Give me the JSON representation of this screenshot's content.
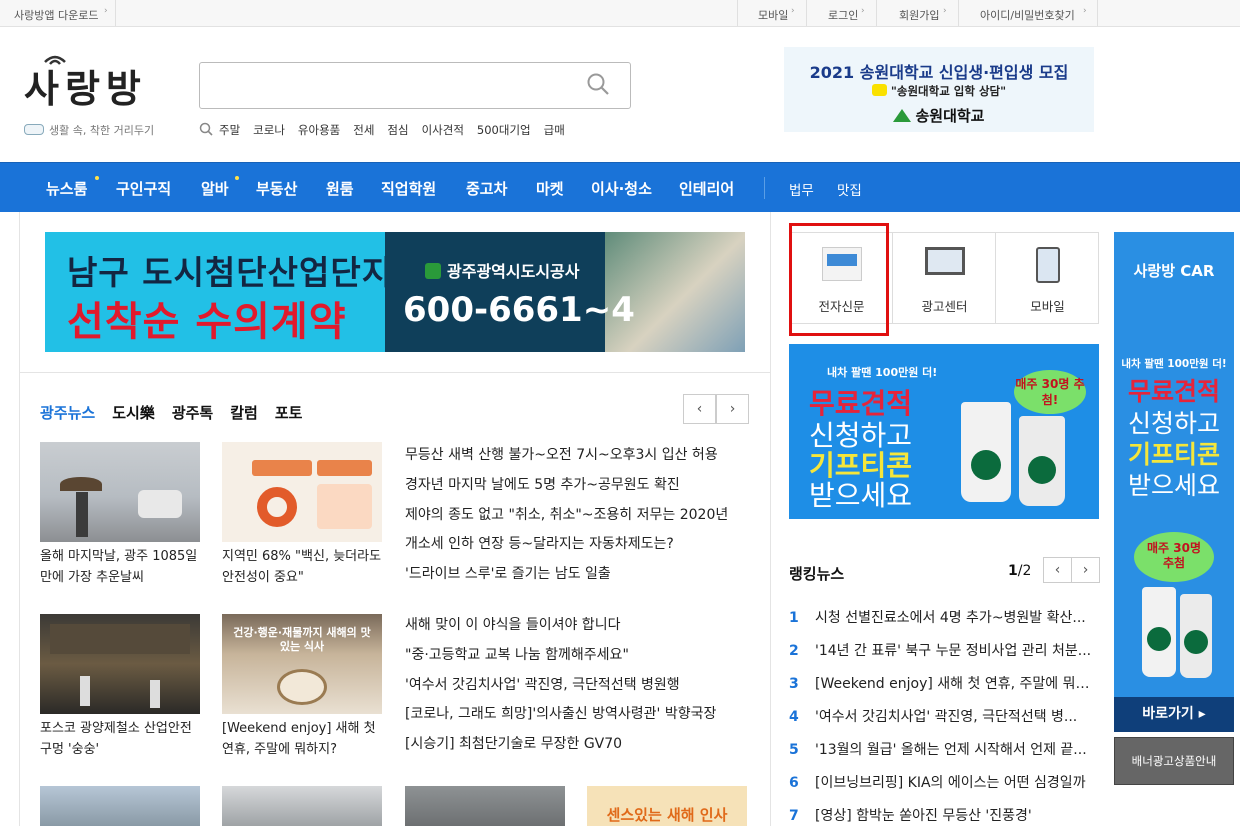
{
  "topbar": {
    "app_download": "사랑방앱 다운로드",
    "mobile": "모바일",
    "login": "로그인",
    "signup": "회원가입",
    "find_account": "아이디/비밀번호찾기"
  },
  "header": {
    "logo_text": "사랑방",
    "slogan": "생활 속, 착한 거리두기",
    "search_placeholder": "",
    "hot_keywords": [
      "주말",
      "코로나",
      "유아용품",
      "전세",
      "점심",
      "이사견적",
      "500대기업",
      "급매"
    ]
  },
  "top_ad": {
    "line1": "2021 송원대학교 신입생·편입생 모집",
    "line2": "\"송원대학교 입학 상담\"",
    "line3": "송원대학교"
  },
  "nav": {
    "items": [
      "뉴스룸",
      "구인구직",
      "알바",
      "부동산",
      "원룸",
      "직업학원",
      "중고차",
      "마켓",
      "이사·청소",
      "인테리어"
    ],
    "extra": [
      "법무",
      "맛집"
    ]
  },
  "main_banner": {
    "line1": "남구 도시첨단산업단지",
    "line2": "선착순 수의계약",
    "org": "광주광역시도시공사",
    "phone": "600-6661~4"
  },
  "news": {
    "tabs": [
      "광주뉴스",
      "도시樂",
      "광주톡",
      "칼럼",
      "포토"
    ],
    "prev": "‹",
    "next": "›",
    "photo_captions": [
      "올해 마지막날, 광주 1085일만에 가장 추운날씨",
      "지역민 68% \"백신, 늦더라도 안전성이 중요\"",
      "포스코 광양제철소 산업안전 구멍 '숭숭'",
      "[Weekend enjoy] 새해 첫 연휴, 주말에 뭐하지?"
    ],
    "headlines_1": [
      "무등산 새벽 산행 불가~오전 7시~오후3시 입산 허용",
      "경자년 마지막 날에도 5명 추가~공무원도 확진",
      "제야의 종도 없고 \"취소, 취소\"~조용히 저무는 2020년",
      "개소세 인하 연장 등~달라지는 자동차제도는?",
      "'드라이브 스루'로 즐기는 남도 일출"
    ],
    "headlines_2": [
      "새해 맞이 이 야식을 들이셔야 합니다",
      "\"중·고등학교 교복 나눔 함께해주세요\"",
      "'여수서 갓김치사업' 곽진영, 극단적선택 병원행",
      "[코로나, 그래도 희망]'의사출신 방역사령관' 박향국장",
      "[시승기] 최첨단기술로 무장한 GV70"
    ],
    "photo2_overlay": "건강·행운·재물까지 새해의 맛있는 식사",
    "photo_bottom_overlay": "센스있는 새해 인사"
  },
  "quick_links": [
    "전자신문",
    "광고센터",
    "모바일"
  ],
  "mid_ad": {
    "top": "내차 팔땐 100만원 더!",
    "l1": "무료견적",
    "l2": "신청하고",
    "l3": "기프티콘",
    "l4": "받으세요",
    "badge": "매주 30명 추첨!"
  },
  "ranking": {
    "title": "랭킹뉴스",
    "page_current": "1",
    "page_total": "/2",
    "items": [
      {
        "num": "1",
        "text": "시청 선별진료소에서 4명 추가~병원발 확산..."
      },
      {
        "num": "2",
        "text": "'14년 간 표류' 북구 누문 정비사업 관리 처분..."
      },
      {
        "num": "3",
        "text": "[Weekend enjoy] 새해 첫 연휴, 주말에 뭐하지?"
      },
      {
        "num": "4",
        "text": "'여수서 갓김치사업' 곽진영, 극단적선택 병..."
      },
      {
        "num": "5",
        "text": "'13월의 월급' 올해는 언제 시작해서 언제 끝..."
      },
      {
        "num": "6",
        "text": "[이브닝브리핑] KIA의 에이스는 어떤 심경일까"
      },
      {
        "num": "7",
        "text": "[영상] 함박눈 쏟아진 무등산 '진풍경'"
      }
    ]
  },
  "side_ad": {
    "brand": "사랑방 CAR",
    "top": "내차 팔땐 100만원 더!",
    "l1": "무료견적",
    "l2": "신청하고",
    "l3": "기프티콘",
    "l4": "받으세요",
    "badge": "매주 30명 추첨",
    "button": "바로가기 ▸",
    "info": "배너광고상품안내"
  },
  "colors": {
    "brand_blue": "#1a73d8",
    "highlight_red": "#e01010"
  }
}
